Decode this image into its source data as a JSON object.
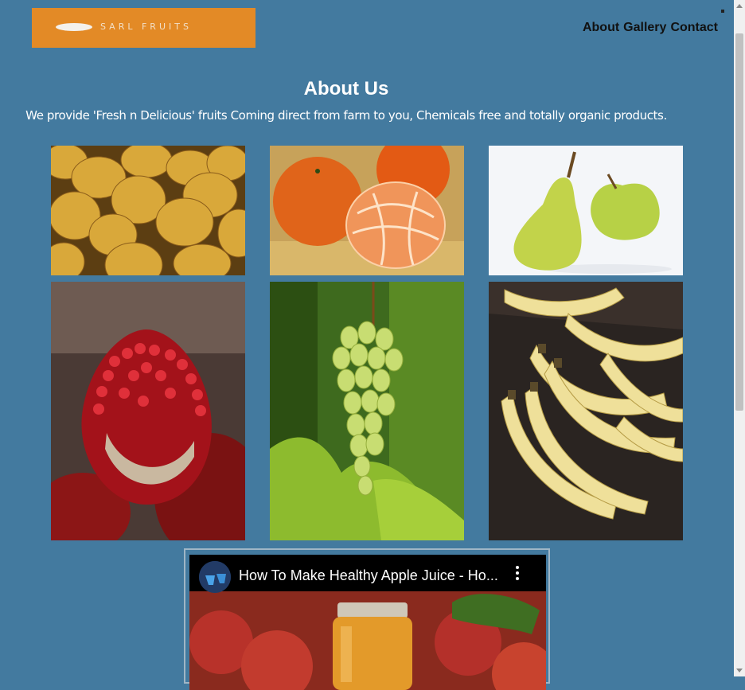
{
  "header": {
    "logo_text": "SARL FRUITS",
    "nav": [
      "About",
      "Gallery",
      "Contact"
    ]
  },
  "main": {
    "title": "About Us",
    "description": "We provide 'Fresh n Delicious' fruits Coming direct from farm to you, Chemicals free and totally organic products."
  },
  "gallery": [
    "mangoes",
    "oranges",
    "pears",
    "pomegranate",
    "grapes",
    "bananas"
  ],
  "video": {
    "title": "How To Make Healthy Apple Juice - Ho..."
  },
  "colors": {
    "background": "#437a9f",
    "logo_bg": "#e38a26"
  }
}
